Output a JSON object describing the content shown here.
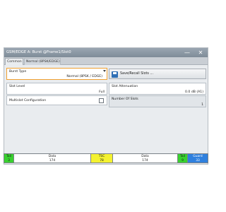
{
  "window": {
    "title": "GSM/EDGE A: Burst @Frame1/Slot0",
    "minimize_icon": "minimize-icon",
    "close_icon": "close-icon"
  },
  "tabs": [
    {
      "label": "Common"
    },
    {
      "label": "Normal (8PSK/EDGE)"
    }
  ],
  "burst_type": {
    "label": "Burst Type",
    "value": "Normal (8PSK / EDGE)"
  },
  "save_recall": {
    "label": "Save/Recall Slots ..."
  },
  "slot_level": {
    "label": "Slot Level",
    "value": "Full"
  },
  "multislot": {
    "label": "Multislot Configuration",
    "checked": false
  },
  "slot_attenuation": {
    "label": "Slot Attenuation",
    "value": "0.0 dB  (A1)"
  },
  "number_of_slots": {
    "label": "Number Of Slots",
    "value": "1"
  },
  "timeline": [
    {
      "name": "Tail",
      "count": "3"
    },
    {
      "name": "Data",
      "count": "174"
    },
    {
      "name": "TSC",
      "count": "78"
    },
    {
      "name": "Data",
      "count": "174"
    },
    {
      "name": "Tail",
      "count": "9"
    },
    {
      "name": "Guard",
      "count": "33"
    }
  ],
  "colors": {
    "tail": "#39d12f",
    "tsc": "#f4f230",
    "guard": "#2f80de",
    "focus_border": "#f0a030"
  }
}
